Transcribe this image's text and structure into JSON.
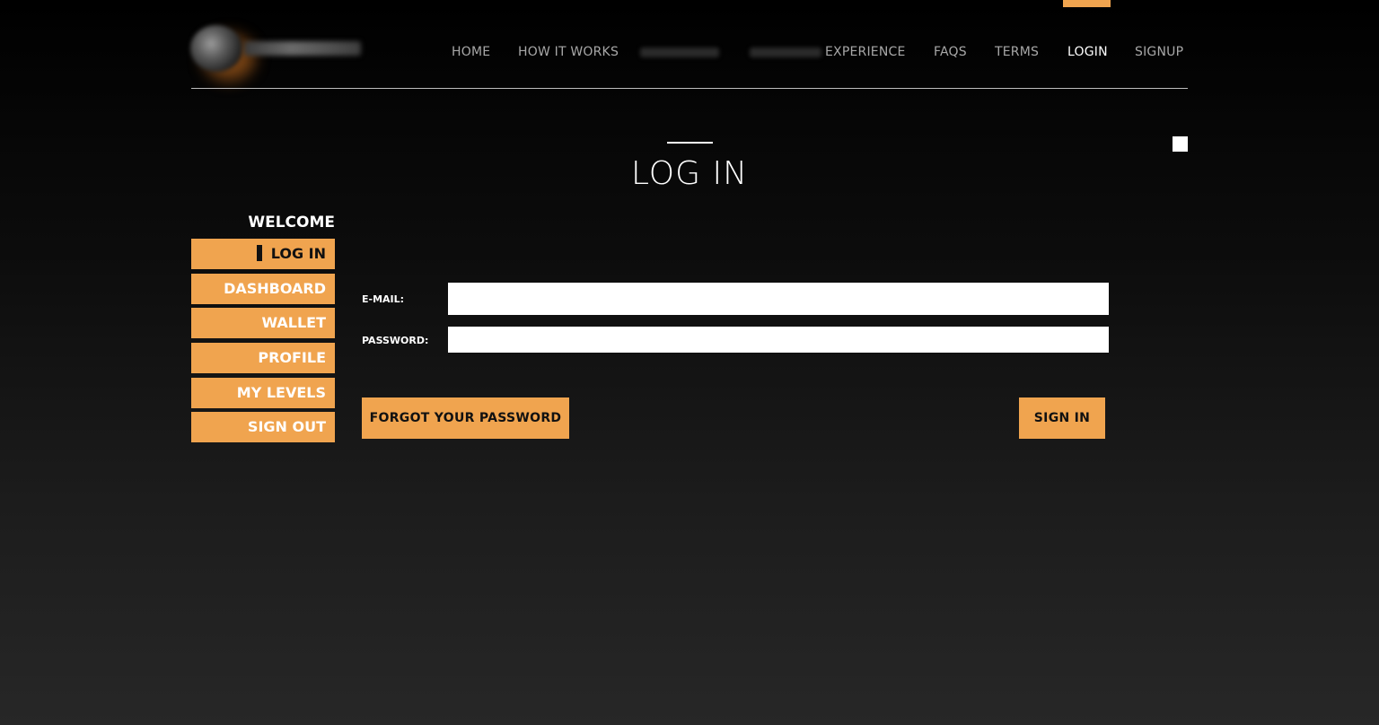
{
  "colors": {
    "accent": "#f0a44f",
    "background_top": "#000000",
    "background_bottom": "#272727",
    "text": "#ffffff",
    "nav_text": "#a8a8a8"
  },
  "logo": {
    "icon": "brand-logo-blurred"
  },
  "topnav": {
    "items": [
      {
        "label": "HOME"
      },
      {
        "label": "HOW IT WORKS"
      },
      {
        "label": "EXPERIENCE"
      },
      {
        "label": "FAQS"
      },
      {
        "label": "TERMS"
      },
      {
        "label": "LOGIN",
        "active": true
      },
      {
        "label": "SIGNUP"
      }
    ]
  },
  "page": {
    "title": "LOG IN"
  },
  "sidebar": {
    "heading": "WELCOME",
    "items": [
      {
        "label": "LOG IN",
        "current": true
      },
      {
        "label": "DASHBOARD"
      },
      {
        "label": "WALLET"
      },
      {
        "label": "PROFILE"
      },
      {
        "label": "MY LEVELS"
      },
      {
        "label": "SIGN OUT"
      }
    ]
  },
  "form": {
    "email_label": "E-MAIL:",
    "email_value": "",
    "password_label": "PASSWORD:",
    "password_value": "",
    "forgot_label": "FORGOT YOUR PASSWORD",
    "signin_label": "SIGN IN"
  }
}
